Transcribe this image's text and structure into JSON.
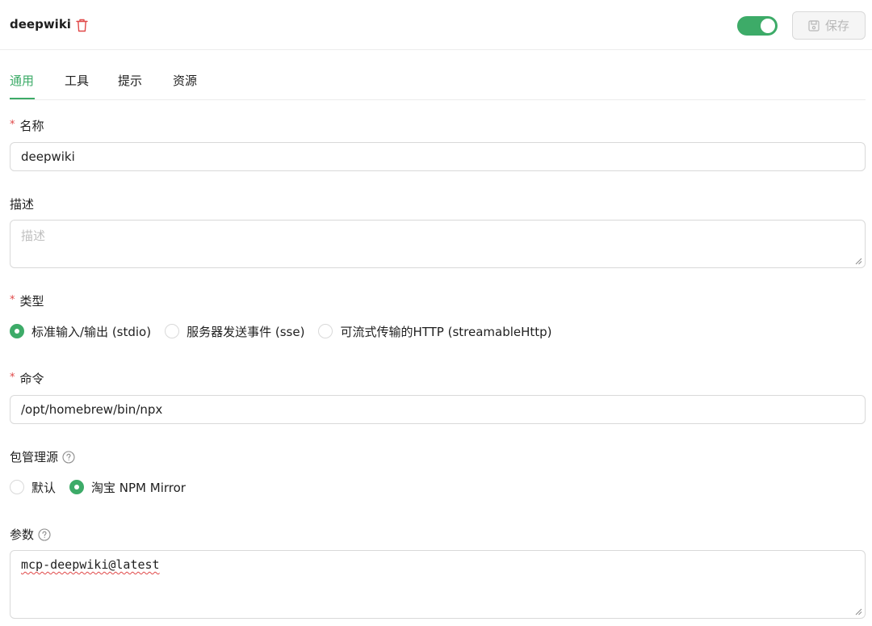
{
  "header": {
    "server_name": "deepwiki",
    "enabled": true,
    "save_label": "保存"
  },
  "tabs": [
    {
      "label": "通用",
      "active": true
    },
    {
      "label": "工具",
      "active": false
    },
    {
      "label": "提示",
      "active": false
    },
    {
      "label": "资源",
      "active": false
    }
  ],
  "form": {
    "required_mark": "*",
    "name": {
      "label": "名称",
      "value": "deepwiki"
    },
    "description": {
      "label": "描述",
      "placeholder": "描述"
    },
    "type": {
      "label": "类型",
      "options": [
        {
          "label": "标准输入/输出 (stdio)",
          "checked": true
        },
        {
          "label": "服务器发送事件 (sse)",
          "checked": false
        },
        {
          "label": "可流式传输的HTTP (streamableHttp)",
          "checked": false
        }
      ]
    },
    "command": {
      "label": "命令",
      "value": "/opt/homebrew/bin/npx"
    },
    "registry": {
      "label": "包管理源",
      "options": [
        {
          "label": "默认",
          "checked": false
        },
        {
          "label": "淘宝 NPM Mirror",
          "checked": true
        }
      ]
    },
    "args": {
      "label": "参数",
      "value": "mcp-deepwiki@latest"
    }
  },
  "colors": {
    "accent": "#3dab68",
    "danger": "#e04848",
    "border": "#d9d9d9"
  }
}
